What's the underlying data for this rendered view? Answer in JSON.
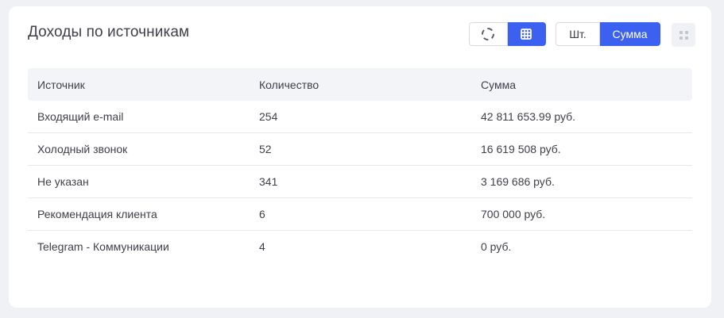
{
  "widget": {
    "title": "Доходы по источникам"
  },
  "toolbar": {
    "view_chart_icon": "pie-chart-icon",
    "view_table_icon": "table-icon",
    "view_active": "table",
    "mode_count_label": "Шт.",
    "mode_sum_label": "Сумма",
    "mode_active": "sum",
    "drag_icon": "drag-handle-icon"
  },
  "table": {
    "columns": [
      "Источник",
      "Количество",
      "Сумма"
    ],
    "rows": [
      {
        "source": "Входящий e-mail",
        "count": "254",
        "sum": "42 811 653.99 руб."
      },
      {
        "source": "Холодный звонок",
        "count": "52",
        "sum": "16 619 508 руб."
      },
      {
        "source": "Не указан",
        "count": "341",
        "sum": "3 169 686 руб."
      },
      {
        "source": "Рекомендация клиента",
        "count": "6",
        "sum": "700 000 руб."
      },
      {
        "source": "Telegram - Коммуникации",
        "count": "4",
        "sum": "0 руб."
      }
    ]
  },
  "colors": {
    "accent": "#3c61f0",
    "text": "#3f4049",
    "header_bg": "#f3f4f8",
    "page_bg": "#f0f1f5"
  }
}
